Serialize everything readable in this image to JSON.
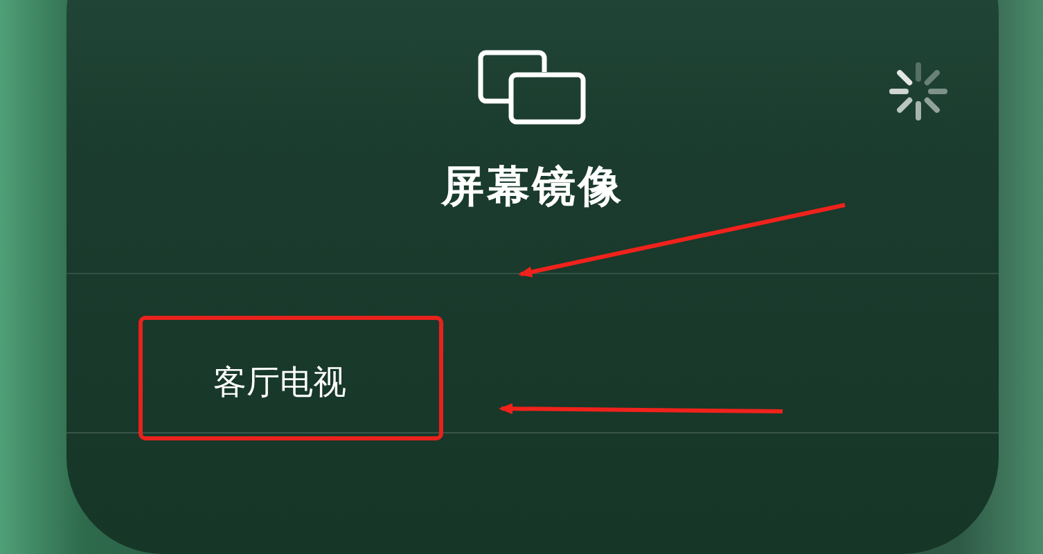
{
  "panel": {
    "title": "屏幕镜像",
    "loading": true
  },
  "devices": [
    {
      "name": "客厅电视"
    }
  ]
}
